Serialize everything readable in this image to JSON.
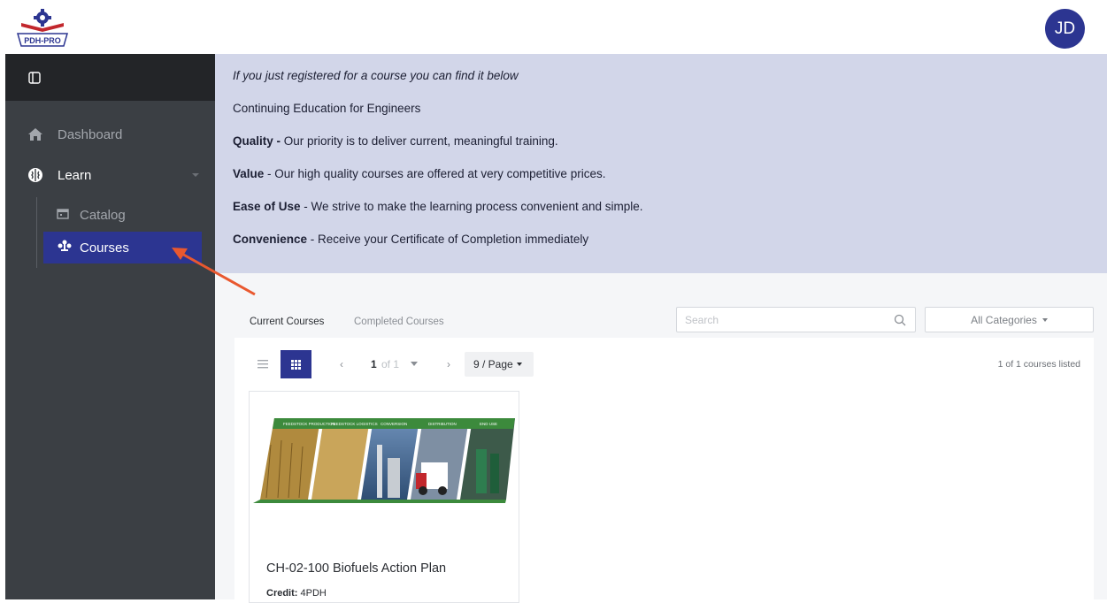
{
  "header": {
    "logo_text": "PDH-PRO",
    "avatar_initials": "JD"
  },
  "sidebar": {
    "items": [
      {
        "label": "Dashboard",
        "icon": "home-icon"
      },
      {
        "label": "Learn",
        "icon": "brain-icon"
      },
      {
        "label": "Catalog",
        "icon": "calendar-icon"
      },
      {
        "label": "Courses",
        "icon": "tree-icon"
      }
    ]
  },
  "banner": {
    "intro": "If you just registered for a course you can find it below",
    "subtitle": "Continuing Education for Engineers",
    "points": [
      {
        "title": "Quality -",
        "text": " Our priority is to deliver current, meaningful training."
      },
      {
        "title": "Value",
        "text": " - Our high quality courses are offered at very competitive prices."
      },
      {
        "title": "Ease of Use",
        "text": " - We strive to make the learning process convenient and simple."
      },
      {
        "title": "Convenience",
        "text": " - Receive your Certificate of Completion immediately"
      }
    ]
  },
  "tabs": {
    "current": "Current Courses",
    "completed": "Completed Courses"
  },
  "search": {
    "placeholder": "Search"
  },
  "filter": {
    "selected": "All Categories"
  },
  "pagination": {
    "prev": "‹",
    "page": "1",
    "of": "of 1",
    "next": "›",
    "per_page": "9 / Page",
    "listed": "1 of 1 courses listed"
  },
  "courses": [
    {
      "title": "CH-02-100 Biofuels Action Plan",
      "credit_label": "Credit:",
      "credit_value": " 4PDH",
      "image_labels": [
        "FEEDSTOCK PRODUCTION",
        "FEEDSTOCK LOGISTICS",
        "CONVERSION",
        "DISTRIBUTION",
        "END USE"
      ]
    }
  ],
  "colors": {
    "primary": "#2c3591",
    "sidebar": "#3b3f44",
    "banner": "#d2d6e9",
    "arrow": "#e9582f"
  }
}
